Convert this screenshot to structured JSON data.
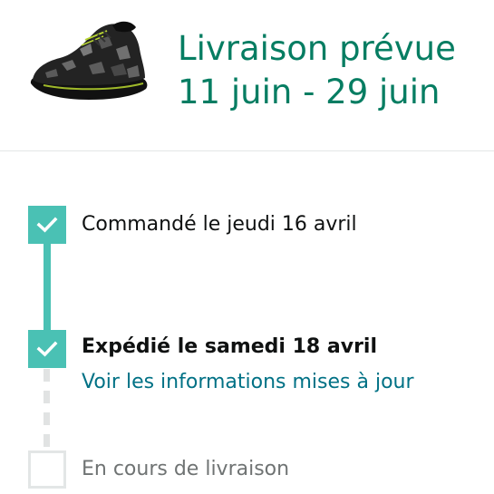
{
  "colors": {
    "accent": "#4ac1b4",
    "eta_text": "#067d62",
    "link": "#007185",
    "pending": "#e3e6e6"
  },
  "product": {
    "image_icon": "shoe-image"
  },
  "delivery": {
    "title_line1": "Livraison prévue",
    "title_line2": "11 juin - 29 juin"
  },
  "steps": [
    {
      "label": "Commandé le jeudi 16 avril",
      "done": true,
      "icon": "check-icon"
    },
    {
      "label": "Expédié le samedi 18 avril",
      "done": true,
      "icon": "check-icon",
      "link": "Voir les informations mises à jour"
    },
    {
      "label": "En cours de livraison",
      "done": false,
      "icon": "empty-checkbox-icon"
    }
  ]
}
